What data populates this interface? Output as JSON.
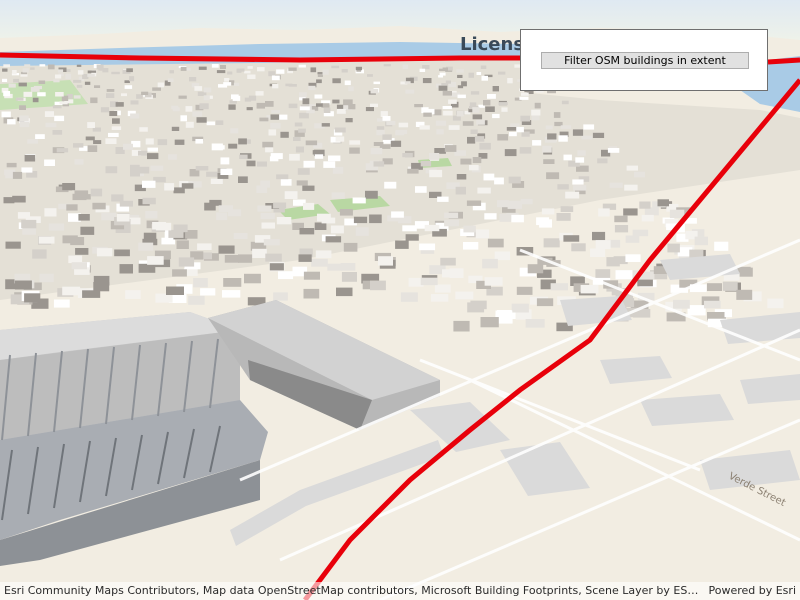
{
  "map": {
    "label": "License",
    "street_label": "Verde Street",
    "colors": {
      "water": "#a9cbe6",
      "ground": "#f2ede2",
      "route_line": "#e8000a",
      "park": "#c7e0b5",
      "building": "#e6e6e6"
    }
  },
  "panel": {
    "filter_button_label": "Filter OSM buildings in extent"
  },
  "attribution": {
    "text": "Esri Community Maps Contributors, Map data OpenStreetMap contributors, Microsoft Building Footprints, Scene Layer by ESRI, Co...",
    "powered_by": "Powered by Esri"
  }
}
